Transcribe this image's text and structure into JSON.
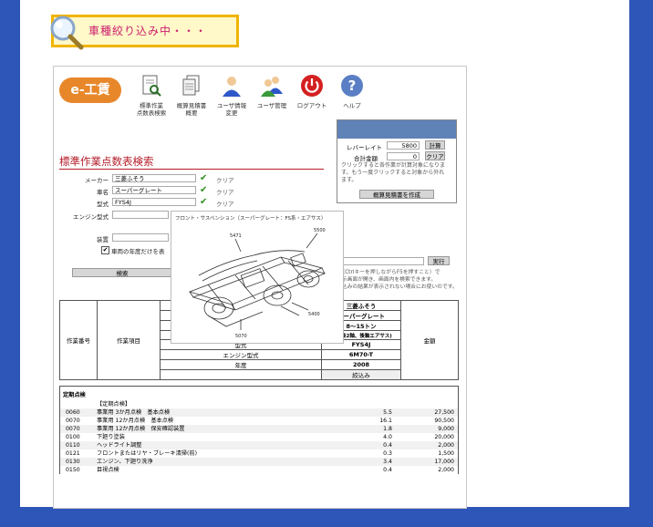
{
  "badge": {
    "text": "車種絞り込み中・・・"
  },
  "toolbar": [
    {
      "label": "標準作業\n点数表検索",
      "icon": "document-search-icon"
    },
    {
      "label": "概算見積書\n概要",
      "icon": "documents-icon"
    },
    {
      "label": "ユーザ情報\n変更",
      "icon": "user-icon"
    },
    {
      "label": "ユーザ管理",
      "icon": "users-icon"
    },
    {
      "label": "ログアウト",
      "icon": "power-icon"
    },
    {
      "label": "ヘルプ",
      "icon": "help-icon"
    }
  ],
  "logo": {
    "text": "e-工賃"
  },
  "section": {
    "title": "標準作業点数表検索"
  },
  "form": {
    "maker_label": "メーカー",
    "maker_value": "三菱ふそう",
    "car_label": "車名",
    "car_value": "スーパーグレート",
    "model_label": "型式",
    "model_value": "FYS4J",
    "engine_label": "エンジン型式",
    "grade_label": "装置",
    "checkbox_label": "車両の年度だけを表",
    "clear": "クリア",
    "search_button": "検索",
    "exec_button": "実行"
  },
  "calc": {
    "lever_label": "レバーレイト",
    "lever_value": "5800",
    "lever_btn": "計算",
    "total_label": "合計金額",
    "total_value": "0",
    "clear_btn": "クリア",
    "note": "クリックすると各作業が計算対象になりま\nす。もう一度クリックすると対象から外れ\nます。",
    "create_btn": "概算見積書を作成"
  },
  "right_note": "F（Ctrlキーを押しながらF5を押すこと）で\n表示画面が開き、画面内を検索できます。\n絞込みの結果が表示されない場合にお使いのです。",
  "popup": {
    "title": "フロント・サスペンション（スーパーグレート：FS系・エアサス）",
    "part_numbers": [
      "5471",
      "5500",
      "5400",
      "5070"
    ]
  },
  "table_header": {
    "work_no": "作業番号",
    "work_item": "作業項目",
    "amount": "金額",
    "spec_rows": [
      {
        "label": "",
        "value": "三菱ふそう"
      },
      {
        "label": "",
        "value": "スーパーグレート"
      },
      {
        "label": "",
        "value": "8～15トン"
      },
      {
        "label": "",
        "value": "3軸(後2軸、後軸エアサス)"
      },
      {
        "label": "型式",
        "value": "FYS4J"
      },
      {
        "label": "エンジン型式",
        "value": "6M70-T"
      },
      {
        "label": "年度",
        "value": "2008"
      },
      {
        "label": "",
        "value": "絞込み"
      }
    ]
  },
  "category": "定期点検",
  "rows": [
    {
      "code": "",
      "name": "【定期点検】",
      "hours": "",
      "price": ""
    },
    {
      "code": "0060",
      "name": "事業用 3か月点検　基本点検",
      "hours": "5.5",
      "price": "27,500"
    },
    {
      "code": "0070",
      "name": "事業用 12か月点検　基本点検",
      "hours": "16.1",
      "price": "90,500"
    },
    {
      "code": "0070",
      "name": "事業用 12か月点検　保安確認装置",
      "hours": "1.8",
      "price": "9,000"
    },
    {
      "code": "0100",
      "name": "下廻り塗装",
      "hours": "4.0",
      "price": "20,000"
    },
    {
      "code": "0110",
      "name": "ヘッドライト調整",
      "hours": "0.4",
      "price": "2,000"
    },
    {
      "code": "0121",
      "name": "フロントまたはリヤ・ブレーキ清掃(前)",
      "hours": "0.3",
      "price": "1,500"
    },
    {
      "code": "0130",
      "name": "エンジン、下廻り洗浄",
      "hours": "3.4",
      "price": "17,000"
    },
    {
      "code": "0150",
      "name": "目視点検",
      "hours": "0.4",
      "price": "2,000"
    }
  ]
}
